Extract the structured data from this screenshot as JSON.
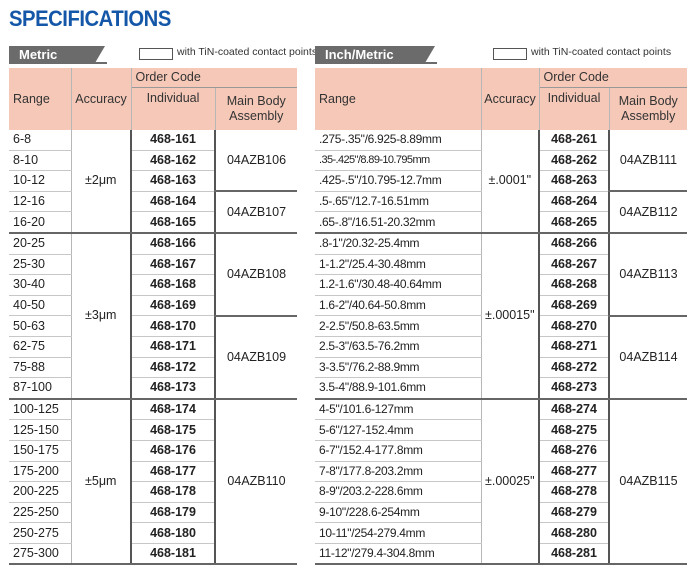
{
  "title": "SPECIFICATIONS",
  "metric": {
    "tab": "Metric",
    "legend": "with TiN-coated contact points",
    "headers": {
      "range": "Range",
      "accuracy": "Accuracy",
      "order_code": "Order Code",
      "individual": "Individual",
      "main_body": "Main Body Assembly"
    },
    "rows": [
      {
        "range": "6-8",
        "code": "468-161"
      },
      {
        "range": "8-10",
        "code": "468-162"
      },
      {
        "range": "10-12",
        "code": "468-163"
      },
      {
        "range": "12-16",
        "code": "468-164"
      },
      {
        "range": "16-20",
        "code": "468-165"
      },
      {
        "range": "20-25",
        "code": "468-166"
      },
      {
        "range": "25-30",
        "code": "468-167"
      },
      {
        "range": "30-40",
        "code": "468-168"
      },
      {
        "range": "40-50",
        "code": "468-169"
      },
      {
        "range": "50-63",
        "code": "468-170"
      },
      {
        "range": "62-75",
        "code": "468-171"
      },
      {
        "range": "75-88",
        "code": "468-172"
      },
      {
        "range": "87-100",
        "code": "468-173"
      },
      {
        "range": "100-125",
        "code": "468-174"
      },
      {
        "range": "125-150",
        "code": "468-175"
      },
      {
        "range": "150-175",
        "code": "468-176"
      },
      {
        "range": "175-200",
        "code": "468-177"
      },
      {
        "range": "200-225",
        "code": "468-178"
      },
      {
        "range": "225-250",
        "code": "468-179"
      },
      {
        "range": "250-275",
        "code": "468-180"
      },
      {
        "range": "275-300",
        "code": "468-181"
      }
    ],
    "accuracy": [
      "±2μm",
      "±3μm",
      "±5μm"
    ],
    "assemblies": [
      "04AZB106",
      "04AZB107",
      "04AZB108",
      "04AZB109",
      "04AZB110"
    ]
  },
  "inch": {
    "tab": "Inch/Metric",
    "legend": "with TiN-coated contact points",
    "headers": {
      "range": "Range",
      "accuracy": "Accuracy",
      "order_code": "Order Code",
      "individual": "Individual",
      "main_body": "Main Body Assembly"
    },
    "rows": [
      {
        "range": ".275-.35\"/6.925-8.89mm",
        "code": "468-261"
      },
      {
        "range": ".35-.425\"/8.89-10.795mm",
        "code": "468-262"
      },
      {
        "range": ".425-.5\"/10.795-12.7mm",
        "code": "468-263"
      },
      {
        "range": ".5-.65\"/12.7-16.51mm",
        "code": "468-264"
      },
      {
        "range": ".65-.8\"/16.51-20.32mm",
        "code": "468-265"
      },
      {
        "range": ".8-1\"/20.32-25.4mm",
        "code": "468-266"
      },
      {
        "range": "1-1.2\"/25.4-30.48mm",
        "code": "468-267"
      },
      {
        "range": "1.2-1.6\"/30.48-40.64mm",
        "code": "468-268"
      },
      {
        "range": "1.6-2\"/40.64-50.8mm",
        "code": "468-269"
      },
      {
        "range": "2-2.5\"/50.8-63.5mm",
        "code": "468-270"
      },
      {
        "range": "2.5-3\"/63.5-76.2mm",
        "code": "468-271"
      },
      {
        "range": "3-3.5\"/76.2-88.9mm",
        "code": "468-272"
      },
      {
        "range": "3.5-4\"/88.9-101.6mm",
        "code": "468-273"
      },
      {
        "range": "4-5\"/101.6-127mm",
        "code": "468-274"
      },
      {
        "range": "5-6\"/127-152.4mm",
        "code": "468-275"
      },
      {
        "range": "6-7\"/152.4-177.8mm",
        "code": "468-276"
      },
      {
        "range": "7-8\"/177.8-203.2mm",
        "code": "468-277"
      },
      {
        "range": "8-9\"/203.2-228.6mm",
        "code": "468-278"
      },
      {
        "range": "9-10\"/228.6-254mm",
        "code": "468-279"
      },
      {
        "range": "10-11\"/254-279.4mm",
        "code": "468-280"
      },
      {
        "range": "11-12\"/279.4-304.8mm",
        "code": "468-281"
      }
    ],
    "accuracy": [
      "±.0001\"",
      "±.00015\"",
      "±.00025\""
    ],
    "assemblies": [
      "04AZB111",
      "04AZB112",
      "04AZB113",
      "04AZB114",
      "04AZB115"
    ]
  }
}
